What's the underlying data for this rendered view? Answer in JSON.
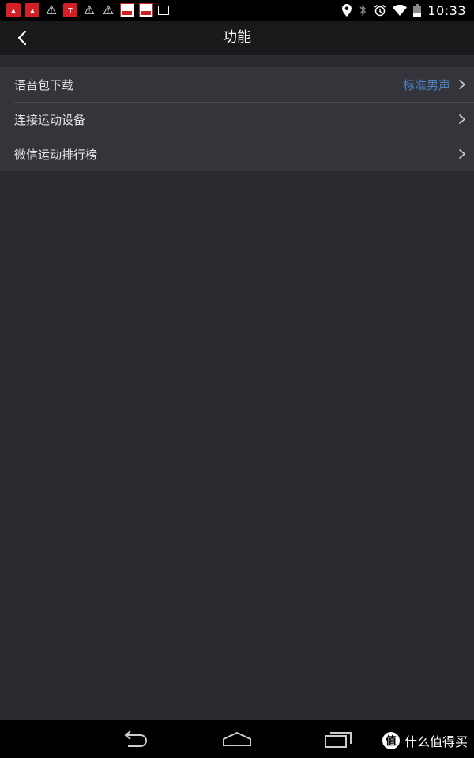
{
  "status_bar": {
    "time": "10:33",
    "notifications": [
      "red-app-icon",
      "red-app-icon",
      "warning-icon",
      "tieba-icon",
      "warning-icon",
      "warning-icon",
      "seal-icon",
      "seal-icon",
      "image-icon"
    ],
    "system_icons": [
      "location-icon",
      "bluetooth-icon",
      "alarm-icon",
      "wifi-icon",
      "battery-icon"
    ]
  },
  "header": {
    "title": "功能"
  },
  "list": {
    "items": [
      {
        "label": "语音包下载",
        "value": "标准男声"
      },
      {
        "label": "连接运动设备",
        "value": ""
      },
      {
        "label": "微信运动排行榜",
        "value": ""
      }
    ]
  },
  "watermark": {
    "logo": "值",
    "text": "什么值得买"
  },
  "colors": {
    "accent": "#4a84c4",
    "background": "#2a2a30",
    "list_bg": "#34343a",
    "header_bg": "#19191c"
  }
}
